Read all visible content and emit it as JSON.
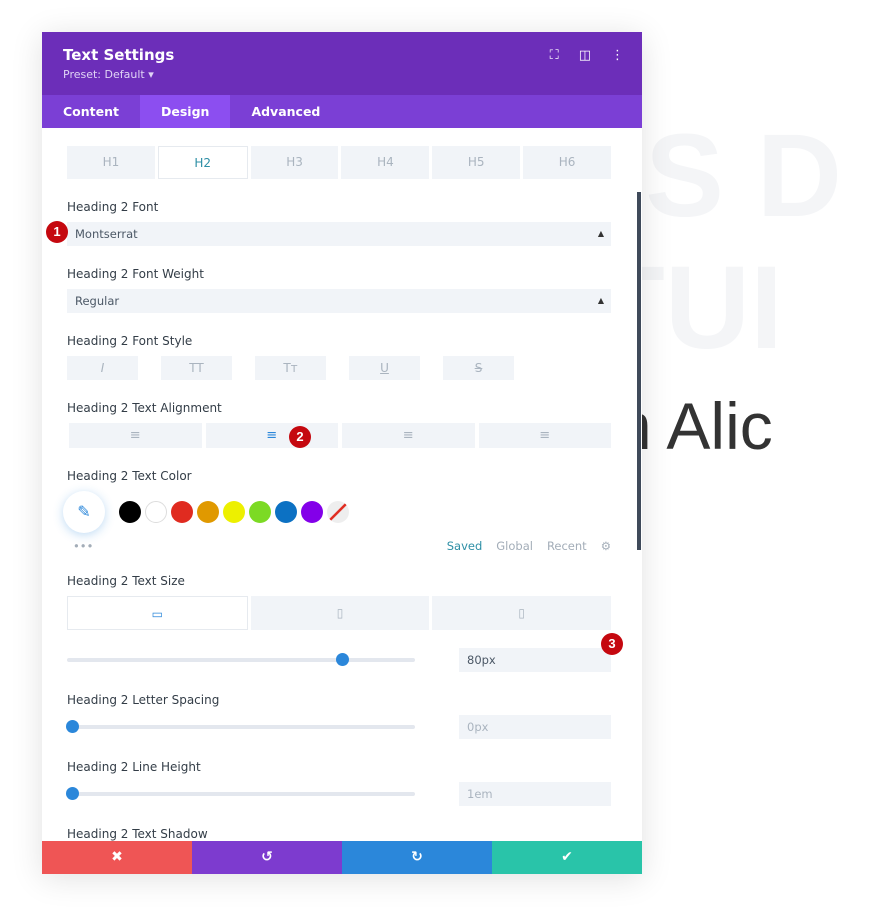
{
  "background": {
    "line1": "US D",
    "line2": "ITUI",
    "line3": "am Alic"
  },
  "header": {
    "title": "Text Settings",
    "preset": "Preset: Default ▾",
    "icons": [
      "focus-icon",
      "split-view-icon",
      "more-icon"
    ]
  },
  "tabs": [
    {
      "label": "Content"
    },
    {
      "label": "Design"
    },
    {
      "label": "Advanced"
    }
  ],
  "heading_tabs": [
    "H1",
    "H2",
    "H3",
    "H4",
    "H5",
    "H6"
  ],
  "font": {
    "label": "Heading 2 Font",
    "value": "Montserrat"
  },
  "weight": {
    "label": "Heading 2 Font Weight",
    "value": "Regular"
  },
  "style": {
    "label": "Heading 2 Font Style",
    "buttons": [
      "I",
      "TT",
      "Tт",
      "U",
      "S"
    ]
  },
  "alignment": {
    "label": "Heading 2 Text Alignment",
    "selected": "center"
  },
  "color": {
    "label": "Heading 2 Text Color",
    "swatches": [
      "#000000",
      "#ffffff",
      "#e02b20",
      "#e09900",
      "#edf000",
      "#7cda24",
      "#0c71c3",
      "#8300e9"
    ],
    "tabs": {
      "saved": "Saved",
      "global": "Global",
      "recent": "Recent"
    },
    "more": "•••"
  },
  "size": {
    "label": "Heading 2 Text Size",
    "value": "80px",
    "slider_percent": 79
  },
  "letter_spacing": {
    "label": "Heading 2 Letter Spacing",
    "value": "0px",
    "slider_percent": 0
  },
  "line_height": {
    "label": "Heading 2 Line Height",
    "value": "1em",
    "slider_percent": 0
  },
  "shadow": {
    "label": "Heading 2 Text Shadow"
  },
  "badges": [
    "1",
    "2",
    "3"
  ],
  "footer": {
    "cancel": "✖",
    "undo": "↺",
    "redo": "↻",
    "save": "✔",
    "colors": [
      "#ef5555",
      "#7d3bcf",
      "#2b87da",
      "#29c4a9"
    ]
  }
}
